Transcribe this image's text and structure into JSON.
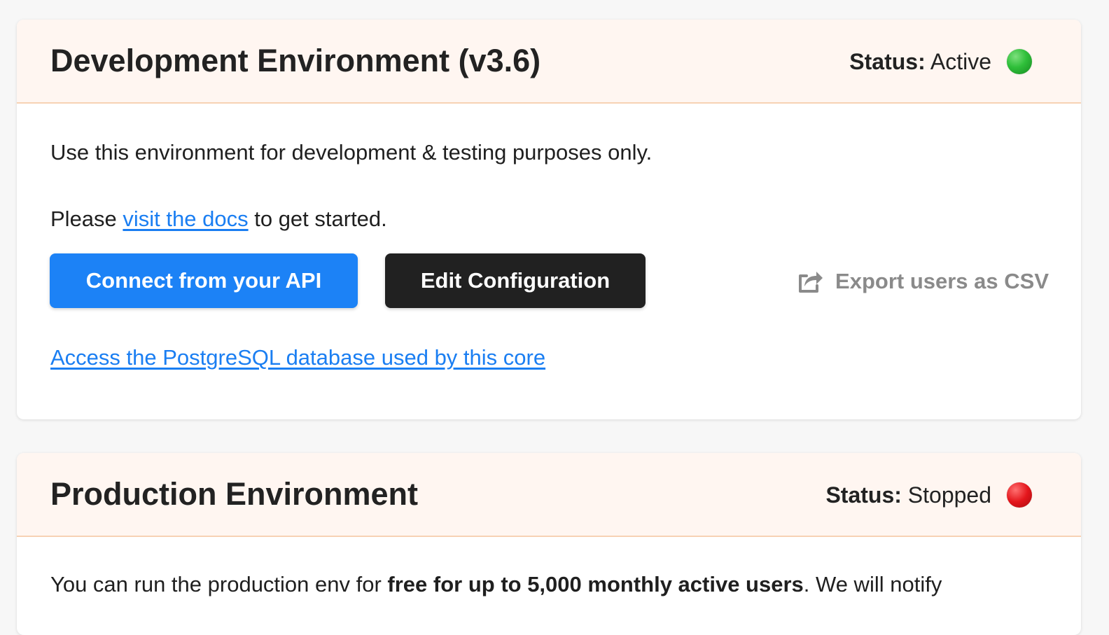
{
  "dev_environment": {
    "title": "Development Environment (v3.6)",
    "status_label": "Status:",
    "status_value": "Active",
    "status_color": "#2fbf3a",
    "description": "Use this environment for development & testing purposes only.",
    "docs_prefix": "Please ",
    "docs_link": "visit the docs",
    "docs_suffix": " to get started.",
    "connect_button": "Connect from your API",
    "edit_button": "Edit Configuration",
    "export_label": "Export users as CSV",
    "export_icon": "share-export-icon",
    "database_link": "Access the PostgreSQL database used by this core"
  },
  "prod_environment": {
    "title": "Production Environment",
    "status_label": "Status:",
    "status_value": "Stopped",
    "status_color": "#e4161c",
    "text_prefix": "You can run the production env for ",
    "text_bold": "free for up to 5,000 monthly active users",
    "text_suffix": ". We will notify"
  },
  "colors": {
    "page_background": "#f7f7f7",
    "header_background": "#fff6f1",
    "header_border": "#f7d2b4",
    "primary_button": "#1c82f6",
    "dark_button": "#212121",
    "link": "#1a7ef2",
    "muted_text": "#8a8a8a"
  }
}
